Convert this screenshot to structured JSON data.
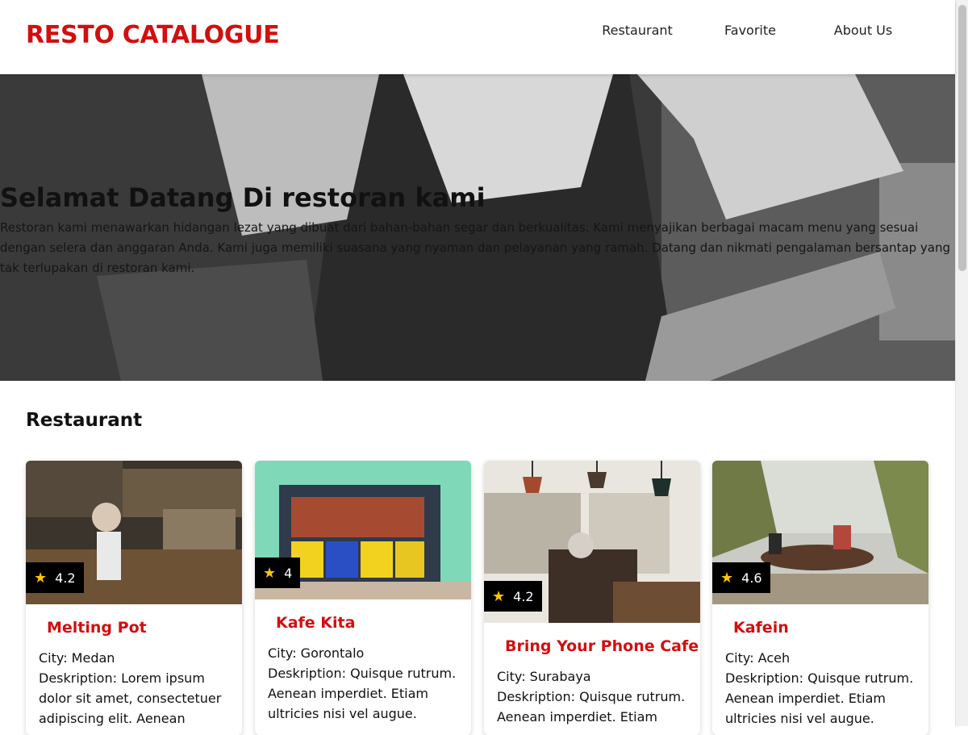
{
  "header": {
    "brand": "RESTO CATALOGUE",
    "nav": [
      "Restaurant",
      "Favorite",
      "About Us"
    ]
  },
  "hero": {
    "title": "Selamat Datang Di restoran kami",
    "description": "Restoran kami menawarkan hidangan lezat yang dibuat dari bahan-bahan segar dan berkualitas. Kami menyajikan berbagai macam menu yang sesuai dengan selera dan anggaran Anda. Kami juga memiliki suasana yang nyaman dan pelayanan yang ramah. Datang dan nikmati pengalaman bersantap yang tak terlupakan di restoran kami."
  },
  "section": {
    "title": "Restaurant"
  },
  "restaurants": [
    {
      "name": "Melting Pot",
      "rating": "4.2",
      "city": "City: Medan",
      "description": "Deskription: Lorem ipsum dolor sit amet, consectetuer adipiscing elit. Aenean"
    },
    {
      "name": "Kafe Kita",
      "rating": "4",
      "city": "City: Gorontalo",
      "description": "Deskription: Quisque rutrum. Aenean imperdiet. Etiam ultricies nisi vel augue."
    },
    {
      "name": "Bring Your Phone Cafe",
      "rating": "4.2",
      "city": "City: Surabaya",
      "description": "Deskription: Quisque rutrum. Aenean imperdiet. Etiam"
    },
    {
      "name": "Kafein",
      "rating": "4.6",
      "city": "City: Aceh",
      "description": "Deskription: Quisque rutrum. Aenean imperdiet. Etiam ultricies nisi vel augue."
    }
  ],
  "icons": {
    "rating": "star-icon"
  },
  "colors": {
    "brand": "#d20f0f",
    "star": "#ffc400"
  }
}
